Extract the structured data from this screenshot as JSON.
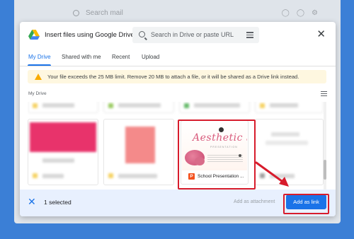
{
  "background": {
    "search_placeholder": "Search mail",
    "color": "#3b7fd6"
  },
  "dialog": {
    "title": "Insert files using Google Drive",
    "search_placeholder": "Search in Drive or paste URL",
    "icons": {
      "logo": "google-drive-icon",
      "search": "search-icon",
      "filter": "tune-icon",
      "close": "close-icon"
    }
  },
  "tabs": [
    {
      "label": "My Drive",
      "active": true
    },
    {
      "label": "Shared with me",
      "active": false
    },
    {
      "label": "Recent",
      "active": false
    },
    {
      "label": "Upload",
      "active": false
    }
  ],
  "warning": {
    "text": "Your file exceeds the 25 MB limit. Remove 20 MB to attach a file, or it will be shared as a Drive link instead.",
    "color": "#f9ab00"
  },
  "breadcrumb": "My Drive",
  "selected_file": {
    "name": "School Presentation ...",
    "thumbnail_title": "Aesthetic Scho",
    "thumbnail_subtitle": "PRESENTATION",
    "type_badge": "P"
  },
  "footer": {
    "selected_text": "1 selected",
    "attach_label": "Add as attachment",
    "link_label": "Add as link"
  },
  "colors": {
    "accent": "#1a73e8",
    "highlight": "#d71c2c",
    "footer_bg": "#e8f0fe",
    "warning_bg": "#fef7e0"
  }
}
